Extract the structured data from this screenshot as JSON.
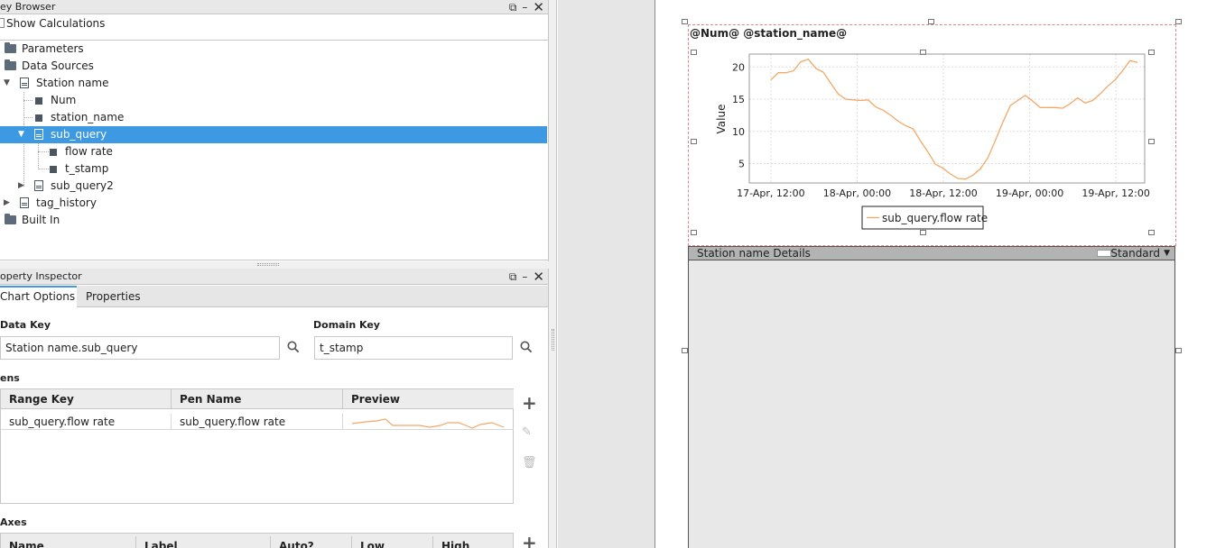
{
  "key_browser": {
    "title": "ey Browser",
    "show_calculations": "Show Calculations",
    "tree": [
      {
        "label": "Parameters"
      },
      {
        "label": "Data Sources"
      },
      {
        "label": "Station name"
      },
      {
        "label": "Num"
      },
      {
        "label": "station_name"
      },
      {
        "label": "sub_query"
      },
      {
        "label": "flow rate"
      },
      {
        "label": "t_stamp"
      },
      {
        "label": "sub_query2"
      },
      {
        "label": "tag_history"
      },
      {
        "label": "Built In"
      }
    ]
  },
  "property_inspector": {
    "title": "operty Inspector",
    "tabs": [
      "Chart Options",
      "Properties"
    ],
    "data_key_label": "Data Key",
    "data_key_value": "Station name.sub_query",
    "domain_key_label": "Domain Key",
    "domain_key_value": "t_stamp",
    "pens_label": "ens",
    "pens_headers": [
      "Range Key",
      "Pen Name",
      "Preview"
    ],
    "pens_rows": [
      {
        "range_key": "sub_query.flow rate",
        "pen_name": "sub_query.flow rate"
      }
    ],
    "axes_label": "Axes",
    "axes_headers": [
      "Name",
      "Label",
      "Auto?",
      "Low",
      "High"
    ]
  },
  "canvas": {
    "header_text": "@Num@  @station_name@",
    "details_label": "Station name Details",
    "details_mode": "Standard"
  },
  "chart_data": {
    "type": "line",
    "ylabel": "Value",
    "xlabel": "",
    "ylim": [
      2,
      22
    ],
    "y_ticks": [
      "5",
      "10",
      "15",
      "20"
    ],
    "x_ticks": [
      "17-Apr, 12:00",
      "18-Apr, 00:00",
      "18-Apr, 12:00",
      "19-Apr, 00:00",
      "19-Apr, 12:00"
    ],
    "series": [
      {
        "name": "sub_query.flow rate",
        "color": "#f4a868",
        "x_hours": [
          0,
          1,
          2,
          3,
          4,
          5,
          6,
          7,
          8,
          9,
          10,
          11,
          12,
          13,
          14,
          15,
          16,
          17,
          18,
          19,
          20,
          21,
          22,
          23,
          24,
          25,
          26,
          27,
          28,
          29,
          30,
          31,
          32,
          33,
          34,
          35,
          36,
          37,
          38,
          39,
          40,
          41,
          42,
          43,
          44,
          45,
          46,
          47,
          48,
          49,
          50,
          51,
          52,
          53,
          54,
          55
        ],
        "values": [
          18.0,
          19.1,
          19.1,
          19.4,
          20.8,
          21.2,
          19.8,
          19.2,
          17.5,
          15.8,
          15.0,
          14.9,
          14.8,
          14.9,
          13.8,
          13.3,
          12.5,
          11.6,
          10.9,
          10.4,
          8.5,
          6.8,
          4.9,
          4.3,
          3.4,
          2.7,
          2.6,
          3.2,
          4.2,
          5.9,
          8.6,
          11.4,
          14.0,
          14.8,
          15.6,
          14.7,
          13.7,
          13.7,
          13.7,
          13.6,
          14.3,
          15.2,
          14.4,
          14.8,
          15.8,
          17.0,
          18.0,
          19.4,
          21.0,
          20.7
        ]
      }
    ],
    "x_tick_hours": [
      0,
      12,
      24,
      36,
      48
    ],
    "xlim_hours": [
      -3,
      52
    ],
    "legend": "bottom"
  },
  "colors": {
    "selection": "#3d99e1",
    "line": "#f4a868",
    "accent": "#3d99e1"
  }
}
